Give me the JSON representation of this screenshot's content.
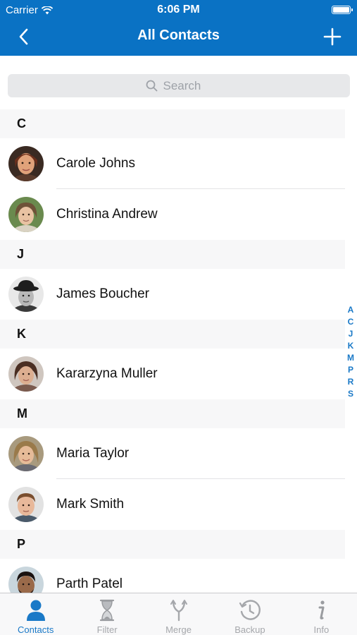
{
  "status": {
    "carrier": "Carrier",
    "time": "6:06 PM"
  },
  "nav": {
    "title": "All Contacts"
  },
  "search": {
    "placeholder": "Search"
  },
  "sections": [
    {
      "letter": "C",
      "contacts": [
        "Carole Johns",
        "Christina Andrew"
      ]
    },
    {
      "letter": "J",
      "contacts": [
        "James Boucher"
      ]
    },
    {
      "letter": "K",
      "contacts": [
        "Kararzyna Muller"
      ]
    },
    {
      "letter": "M",
      "contacts": [
        "Maria Taylor",
        "Mark Smith"
      ]
    },
    {
      "letter": "P",
      "contacts": [
        "Parth Patel"
      ]
    }
  ],
  "index_letters": [
    "A",
    "C",
    "J",
    "K",
    "M",
    "P",
    "R",
    "S"
  ],
  "tabs": [
    {
      "label": "Contacts",
      "icon": "person-icon",
      "active": true
    },
    {
      "label": "Filter",
      "icon": "hourglass-icon",
      "active": false
    },
    {
      "label": "Merge",
      "icon": "merge-icon",
      "active": false
    },
    {
      "label": "Backup",
      "icon": "clock-icon",
      "active": false
    },
    {
      "label": "Info",
      "icon": "info-icon",
      "active": false
    }
  ],
  "colors": {
    "accent": "#0a72c4",
    "tab_active": "#1a79c7",
    "tab_inactive": "#a5a7ab"
  }
}
